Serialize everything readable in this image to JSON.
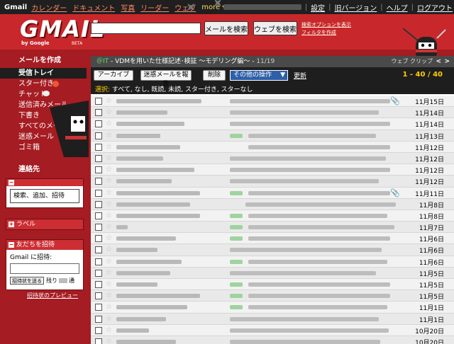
{
  "topbar": {
    "brand": "Gmail",
    "links": [
      "カレンダー",
      "ドキュメント",
      "写真",
      "リーダー",
      "ウェブ"
    ],
    "more": "more ▾",
    "right_links": [
      "設定",
      "旧バージョン",
      "ヘルプ",
      "ログアウト"
    ]
  },
  "header": {
    "logo": "GMAIL",
    "logo_sub": "by Google",
    "logo_beta": "BETA",
    "mail_search_button": "メールを検索",
    "web_search_button": "ウェブを検索",
    "search_links": [
      "検索オプションを表示",
      "フィルタを作成"
    ]
  },
  "sidebar": {
    "compose": "メールを作成",
    "items": [
      {
        "label": "受信トレイ",
        "active": true
      },
      {
        "label": "スター付き",
        "icon": "star-icon"
      },
      {
        "label": "チャット",
        "icon": "chat-bubble-icon"
      },
      {
        "label": "送信済みメール"
      },
      {
        "label": "下書き"
      },
      {
        "label": "すべてのメール"
      },
      {
        "label": "迷惑メール"
      },
      {
        "label": "ゴミ箱"
      }
    ],
    "contacts_label": "連絡先",
    "contacts_search": "検索、追加、招待",
    "labels_panel": "ラベル",
    "invite_panel": "友だちを招待",
    "invite_prompt": "Gmail に招待:",
    "invite_button": "招待状を送る",
    "invite_remaining_prefix": "残り",
    "invite_remaining_suffix": "通",
    "invite_preview": "招待状のプレビュー"
  },
  "main": {
    "ticker_source": "＠IT",
    "ticker_text": " - VDMを用いた仕様記述･検証 ～モデリング編～ - ",
    "ticker_date": "11/19",
    "ticker_ctrl": "ウェブ クリップ",
    "archive_button": "アーカイブ",
    "spam_button": "迷惑メールを報告",
    "delete_button": "削除",
    "more_actions": "その他の操作",
    "refresh": "更新",
    "count": "1 - 40 / 40",
    "select_label": "選択:",
    "select_options": "すべて, なし, 既読, 未読, スター付き, スターなし",
    "rows": [
      {
        "date": "11月15日",
        "attach": true
      },
      {
        "date": "11月14日"
      },
      {
        "date": "11月14日"
      },
      {
        "date": "11月13日"
      },
      {
        "date": "11月12日"
      },
      {
        "date": "11月12日"
      },
      {
        "date": "11月12日"
      },
      {
        "date": "11月12日"
      },
      {
        "date": "11月11日",
        "attach": true
      },
      {
        "date": "11月8日"
      },
      {
        "date": "11月8日"
      },
      {
        "date": "11月7日"
      },
      {
        "date": "11月6日"
      },
      {
        "date": "11月6日"
      },
      {
        "date": "11月6日"
      },
      {
        "date": "11月5日"
      },
      {
        "date": "11月5日"
      },
      {
        "date": "11月5日"
      },
      {
        "date": "11月1日"
      },
      {
        "date": "11月1日"
      },
      {
        "date": "10月20日"
      },
      {
        "date": "10月20日"
      }
    ]
  },
  "colors": {
    "page_red": "#a51c22",
    "header_red": "#c8282c",
    "count_yellow": "#ffcc00",
    "more_actions_blue": "#2e5fa8"
  }
}
